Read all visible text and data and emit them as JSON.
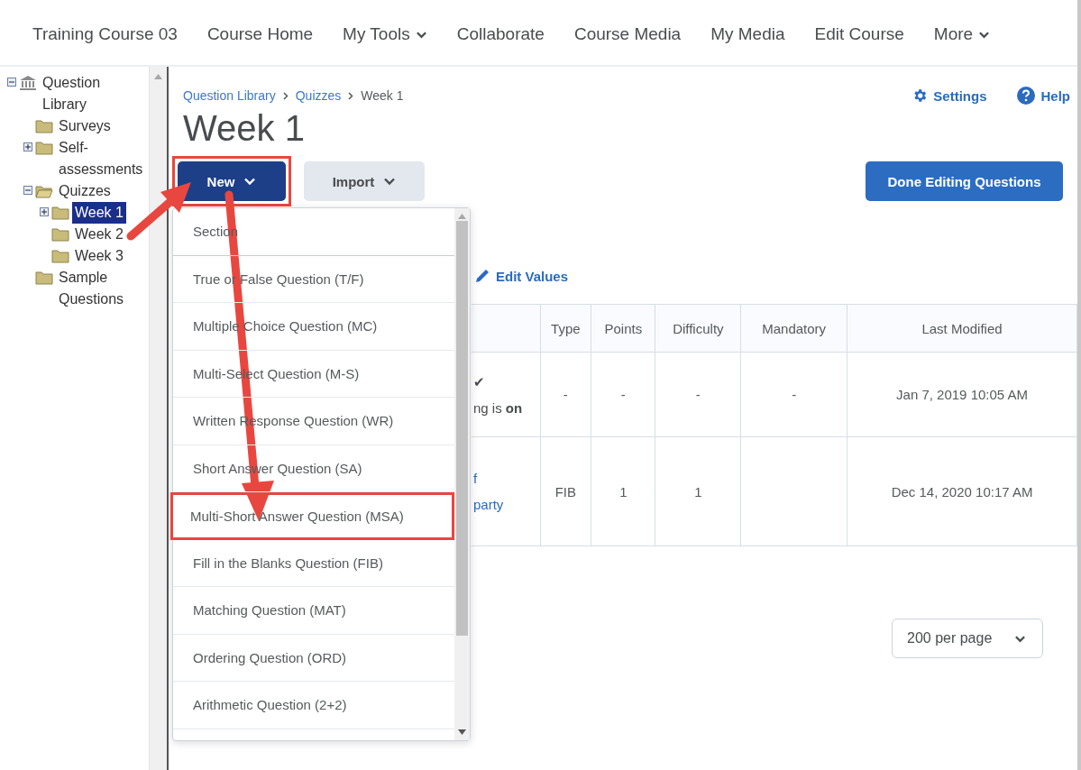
{
  "nav": {
    "course_title": "Training Course 03",
    "items": [
      {
        "label": "Course Home",
        "dropdown": false
      },
      {
        "label": "My Tools",
        "dropdown": true
      },
      {
        "label": "Collaborate",
        "dropdown": false
      },
      {
        "label": "Course Media",
        "dropdown": false
      },
      {
        "label": "My Media",
        "dropdown": false
      },
      {
        "label": "Edit Course",
        "dropdown": false
      },
      {
        "label": "More",
        "dropdown": true
      }
    ]
  },
  "tree": [
    {
      "label": "Question Library",
      "kind": "library",
      "expanded": true,
      "selected": false,
      "children": [
        {
          "label": "Surveys",
          "kind": "folder",
          "selected": false
        },
        {
          "label": "Self-assessments",
          "kind": "folder",
          "expanded": false,
          "selected": false
        },
        {
          "label": "Quizzes",
          "kind": "folder",
          "expanded": true,
          "selected": false,
          "children": [
            {
              "label": "Week 1",
              "kind": "folder",
              "expanded": false,
              "selected": true
            },
            {
              "label": "Week 2",
              "kind": "folder",
              "selected": false
            },
            {
              "label": "Week 3",
              "kind": "folder",
              "selected": false
            }
          ]
        },
        {
          "label": "Sample Questions",
          "kind": "folder",
          "selected": false
        }
      ]
    }
  ],
  "breadcrumbs": [
    {
      "label": "Question Library",
      "kind": "link"
    },
    {
      "label": "Quizzes",
      "kind": "link"
    },
    {
      "label": "Week 1",
      "kind": "current"
    }
  ],
  "header_links": [
    {
      "label": "Settings",
      "kind": "settings"
    },
    {
      "label": "Help",
      "kind": "help"
    }
  ],
  "title": "Week 1",
  "toolbar": {
    "buttons": [
      {
        "label": "New",
        "kind": "primary",
        "highlighted": true
      },
      {
        "label": "Import",
        "kind": "secondary",
        "highlighted": false
      }
    ],
    "done_button": "Done Editing Questions"
  },
  "edit_values_link": "Edit Values",
  "table": {
    "columns": [
      "Type",
      "Points",
      "Difficulty",
      "Mandatory",
      "Last Modified"
    ],
    "rows": [
      {
        "column_1": [
          {
            "text": "✔",
            "kind": "mark"
          },
          {
            "text": "ng is **on**",
            "kind": "text"
          }
        ],
        "cells": [
          "-",
          "-",
          "-",
          "-",
          "Jan 7, 2019 10:05 AM"
        ]
      },
      {
        "column_1": [
          {
            "text": "f",
            "kind": "link"
          },
          {
            "text": "party",
            "kind": "link"
          }
        ],
        "cells": [
          "FIB",
          "1",
          "1",
          "",
          "Dec 14, 2020 10:17 AM"
        ]
      }
    ]
  },
  "pager": {
    "value": "200 per page"
  },
  "new_menu": {
    "items": [
      {
        "label": "Section",
        "highlighted": false
      },
      {
        "label": "True or False Question (T/F)",
        "highlighted": false
      },
      {
        "label": "Multiple Choice Question (MC)",
        "highlighted": false
      },
      {
        "label": "Multi-Select Question (M-S)",
        "highlighted": false
      },
      {
        "label": "Written Response Question (WR)",
        "highlighted": false
      },
      {
        "label": "Short Answer Question (SA)",
        "highlighted": false
      },
      {
        "label": "Multi-Short Answer Question (MSA)",
        "highlighted": true
      },
      {
        "label": "Fill in the Blanks Question (FIB)",
        "highlighted": false
      },
      {
        "label": "Matching Question (MAT)",
        "highlighted": false
      },
      {
        "label": "Ordering Question (ORD)",
        "highlighted": false
      },
      {
        "label": "Arithmetic Question (2+2)",
        "highlighted": false
      }
    ]
  }
}
